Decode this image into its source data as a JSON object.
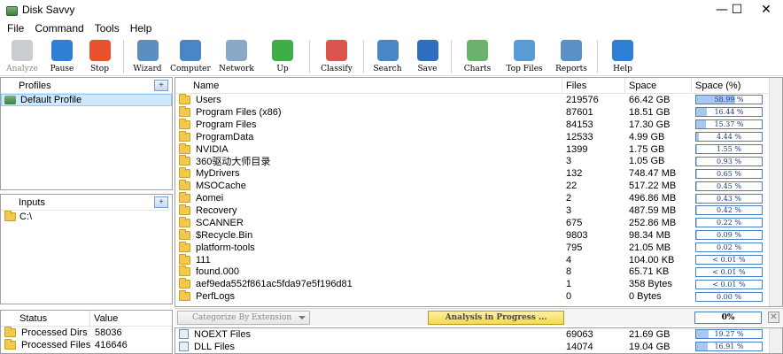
{
  "window": {
    "title": "Disk Savvy",
    "min": "—",
    "max": "☐",
    "close": "✕"
  },
  "menu": [
    "File",
    "Command",
    "Tools",
    "Help"
  ],
  "toolbar": [
    {
      "label": "Analyze",
      "icon": "analyze-icon",
      "color": "#9ca3ab",
      "disabled": true
    },
    {
      "label": "Pause",
      "icon": "pause-icon",
      "color": "#2f7fd6"
    },
    {
      "label": "Stop",
      "icon": "stop-icon",
      "color": "#e8512c"
    },
    {
      "label": "Wizard",
      "icon": "wizard-icon",
      "color": "#5c8fbf"
    },
    {
      "label": "Computer",
      "icon": "computer-icon",
      "color": "#4a86c5"
    },
    {
      "label": "Network",
      "icon": "network-icon",
      "color": "#8aa9c9"
    },
    {
      "label": "Up",
      "icon": "up-arrow-icon",
      "color": "#3fae49"
    },
    {
      "label": "Classify",
      "icon": "classify-icon",
      "color": "#d9534f"
    },
    {
      "label": "Search",
      "icon": "search-icon",
      "color": "#4a86c5"
    },
    {
      "label": "Save",
      "icon": "save-icon",
      "color": "#2f6fbf"
    },
    {
      "label": "Charts",
      "icon": "charts-icon",
      "color": "#6bb36b"
    },
    {
      "label": "Top Files",
      "icon": "top-files-icon",
      "color": "#5a9bd5"
    },
    {
      "label": "Reports",
      "icon": "reports-icon",
      "color": "#5a8fc8"
    },
    {
      "label": "Help",
      "icon": "help-icon",
      "color": "#2f7fd6"
    }
  ],
  "profiles": {
    "header": "Profiles",
    "items": [
      "Default Profile"
    ]
  },
  "inputs": {
    "header": "Inputs",
    "items": [
      "C:\\"
    ]
  },
  "status": {
    "col_status": "Status",
    "col_value": "Value",
    "rows": [
      {
        "name": "Processed Dirs",
        "value": "58036"
      },
      {
        "name": "Processed Files",
        "value": "416646"
      }
    ]
  },
  "files": {
    "col_name": "Name",
    "col_files": "Files",
    "col_space": "Space",
    "col_pct": "Space (%)",
    "rows": [
      {
        "name": "Users",
        "files": "219576",
        "space": "66.42 GB",
        "pct": "58.99 %",
        "frac": 0.59
      },
      {
        "name": "Program Files (x86)",
        "files": "87601",
        "space": "18.51 GB",
        "pct": "16.44 %",
        "frac": 0.164
      },
      {
        "name": "Program Files",
        "files": "84153",
        "space": "17.30 GB",
        "pct": "15.37 %",
        "frac": 0.154
      },
      {
        "name": "ProgramData",
        "files": "12533",
        "space": "4.99 GB",
        "pct": "4.44 %",
        "frac": 0.044
      },
      {
        "name": "NVIDIA",
        "files": "1399",
        "space": "1.75 GB",
        "pct": "1.55 %",
        "frac": 0.016
      },
      {
        "name": "360驱动大师目录",
        "files": "3",
        "space": "1.05 GB",
        "pct": "0.93 %",
        "frac": 0.009
      },
      {
        "name": "MyDrivers",
        "files": "132",
        "space": "748.47 MB",
        "pct": "0.65 %",
        "frac": 0.007
      },
      {
        "name": "MSOCache",
        "files": "22",
        "space": "517.22 MB",
        "pct": "0.45 %",
        "frac": 0.005
      },
      {
        "name": "Aomei",
        "files": "2",
        "space": "496.86 MB",
        "pct": "0.43 %",
        "frac": 0.004
      },
      {
        "name": "Recovery",
        "files": "3",
        "space": "487.59 MB",
        "pct": "0.42 %",
        "frac": 0.004
      },
      {
        "name": "SCANNER",
        "files": "675",
        "space": "252.86 MB",
        "pct": "0.22 %",
        "frac": 0.002
      },
      {
        "name": "$Recycle.Bin",
        "files": "9803",
        "space": "98.34 MB",
        "pct": "0.09 %",
        "frac": 0.001
      },
      {
        "name": "platform-tools",
        "files": "795",
        "space": "21.05 MB",
        "pct": "0.02 %",
        "frac": 0
      },
      {
        "name": "111",
        "files": "4",
        "space": "104.00 KB",
        "pct": "< 0.01 %",
        "frac": 0
      },
      {
        "name": "found.000",
        "files": "8",
        "space": "65.71 KB",
        "pct": "< 0.01 %",
        "frac": 0
      },
      {
        "name": "aef9eda552f861ac5fda97e5f196d81",
        "files": "1",
        "space": "358 Bytes",
        "pct": "< 0.01 %",
        "frac": 0
      },
      {
        "name": "PerfLogs",
        "files": "0",
        "space": "0 Bytes",
        "pct": "0.00 %",
        "frac": 0
      }
    ]
  },
  "bottom_bar": {
    "combo": "Categorize By Extension",
    "analysis": "Analysis in Progress ...",
    "progress": "0%",
    "close": "✕"
  },
  "categories": {
    "rows": [
      {
        "name": "NOEXT Files",
        "files": "69063",
        "space": "21.69 GB",
        "pct": "19.27 %",
        "frac": 0.193
      },
      {
        "name": "DLL Files",
        "files": "14074",
        "space": "19.04 GB",
        "pct": "16.91 %",
        "frac": 0.169
      }
    ]
  }
}
